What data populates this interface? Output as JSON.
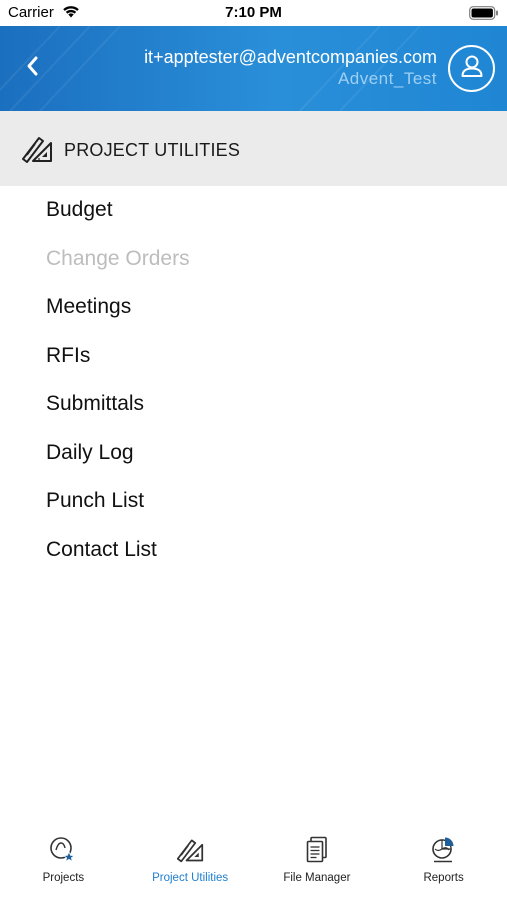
{
  "status_bar": {
    "carrier": "Carrier",
    "time": "7:10 PM"
  },
  "header": {
    "email": "it+apptester@adventcompanies.com",
    "username": "Advent_Test",
    "back_icon": "chevron-left-icon",
    "avatar_icon": "user-icon"
  },
  "section": {
    "title": "PROJECT UTILITIES",
    "icon": "drafting-tools-icon"
  },
  "menu": {
    "items": [
      {
        "label": "Budget",
        "enabled": true
      },
      {
        "label": "Change Orders",
        "enabled": false
      },
      {
        "label": "Meetings",
        "enabled": true
      },
      {
        "label": "RFIs",
        "enabled": true
      },
      {
        "label": "Submittals",
        "enabled": true
      },
      {
        "label": "Daily Log",
        "enabled": true
      },
      {
        "label": "Punch List",
        "enabled": true
      },
      {
        "label": "Contact List",
        "enabled": true
      }
    ]
  },
  "tabs": [
    {
      "label": "Projects",
      "icon": "projects-icon",
      "active": false
    },
    {
      "label": "Project Utilities",
      "icon": "drafting-tools-icon",
      "active": true
    },
    {
      "label": "File Manager",
      "icon": "documents-icon",
      "active": false
    },
    {
      "label": "Reports",
      "icon": "pie-chart-icon",
      "active": false
    }
  ],
  "colors": {
    "header": "#1f86d4",
    "accent": "#1f7fd0",
    "section_bg": "#ebebeb",
    "disabled": "#bdbdbd"
  }
}
